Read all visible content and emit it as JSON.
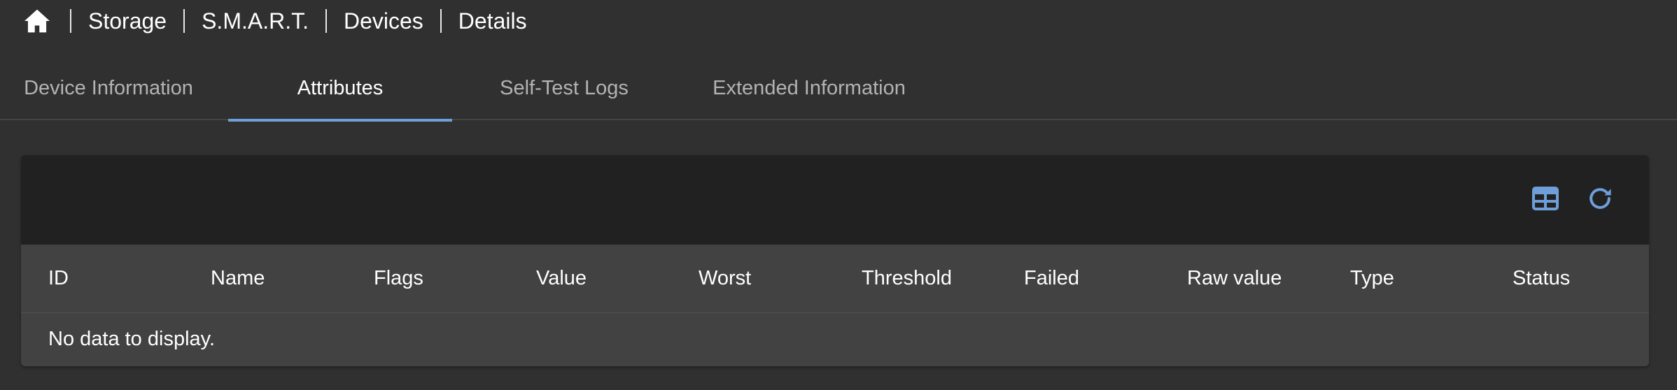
{
  "breadcrumb": {
    "home_icon": "home-icon",
    "items": [
      "Storage",
      "S.M.A.R.T.",
      "Devices",
      "Details"
    ]
  },
  "tabs": [
    {
      "label": "Device Information",
      "active": false
    },
    {
      "label": "Attributes",
      "active": true
    },
    {
      "label": "Self-Test Logs",
      "active": false
    },
    {
      "label": "Extended Information",
      "active": false
    }
  ],
  "toolbar": {
    "columns_icon": "table-columns-icon",
    "refresh_icon": "refresh-icon",
    "icon_color": "#6e9fd8"
  },
  "table": {
    "columns": [
      "ID",
      "Name",
      "Flags",
      "Value",
      "Worst",
      "Threshold",
      "Failed",
      "Raw value",
      "Type",
      "Status"
    ],
    "empty_message": "No data to display."
  },
  "colors": {
    "background": "#303030",
    "card": "#424242",
    "toolbar": "#212121",
    "accent": "#6e9fd8"
  }
}
